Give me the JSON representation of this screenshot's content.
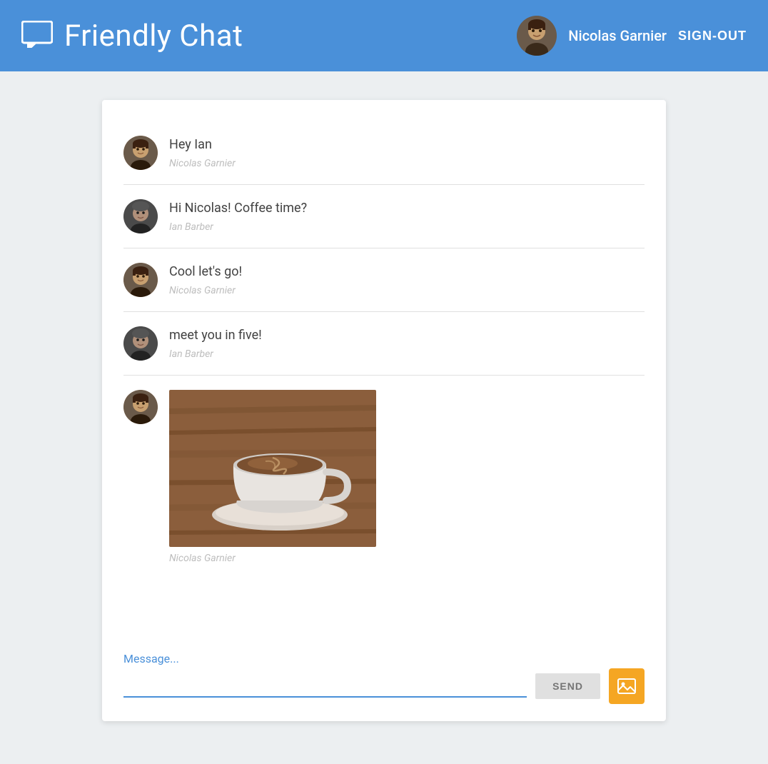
{
  "header": {
    "title": "Friendly Chat",
    "user_name": "Nicolas Garnier",
    "sign_out_label": "SIGN-OUT"
  },
  "messages": [
    {
      "id": 1,
      "text": "Hey Ian",
      "author": "Nicolas Garnier",
      "avatar_type": "nicolas",
      "type": "text"
    },
    {
      "id": 2,
      "text": "Hi Nicolas! Coffee time?",
      "author": "Ian Barber",
      "avatar_type": "ian",
      "type": "text"
    },
    {
      "id": 3,
      "text": "Cool let's go!",
      "author": "Nicolas Garnier",
      "avatar_type": "nicolas",
      "type": "text"
    },
    {
      "id": 4,
      "text": "meet you in five!",
      "author": "Ian Barber",
      "avatar_type": "ian",
      "type": "text"
    },
    {
      "id": 5,
      "text": "",
      "author": "Nicolas Garnier",
      "avatar_type": "nicolas",
      "type": "image"
    }
  ],
  "input": {
    "placeholder": "Message...",
    "send_label": "SEND"
  },
  "colors": {
    "header_bg": "#4a90d9",
    "accent": "#4a90d9",
    "send_bg": "#e0e0e0",
    "image_btn_bg": "#f5a623"
  }
}
